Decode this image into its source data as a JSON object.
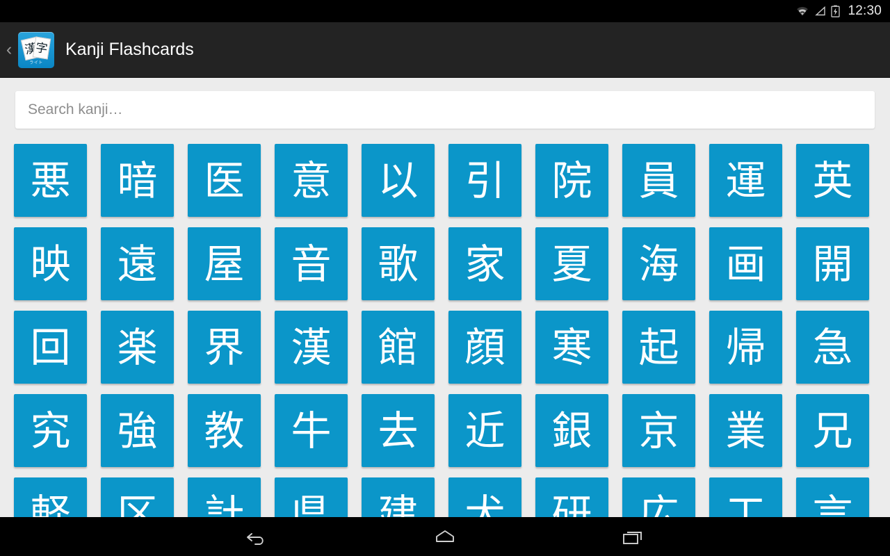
{
  "status_bar": {
    "clock": "12:30",
    "icons": [
      "wifi-icon",
      "signal-icon",
      "battery-charging-icon"
    ]
  },
  "action_bar": {
    "up_caret": "‹",
    "title": "Kanji Flashcards",
    "app_icon": {
      "name": "kanji-flashcards-app-icon",
      "card_back_char": "漢",
      "card_front_char": "字",
      "sub_label": "ライト"
    }
  },
  "search": {
    "placeholder": "Search kanji…",
    "value": ""
  },
  "grid": {
    "columns": 10,
    "rows": [
      [
        "悪",
        "暗",
        "医",
        "意",
        "以",
        "引",
        "院",
        "員",
        "運",
        "英"
      ],
      [
        "映",
        "遠",
        "屋",
        "音",
        "歌",
        "家",
        "夏",
        "海",
        "画",
        "開"
      ],
      [
        "回",
        "楽",
        "界",
        "漢",
        "館",
        "顔",
        "寒",
        "起",
        "帰",
        "急"
      ],
      [
        "究",
        "強",
        "教",
        "牛",
        "去",
        "近",
        "銀",
        "京",
        "業",
        "兄"
      ],
      [
        "軽",
        "区",
        "計",
        "県",
        "建",
        "犬",
        "研",
        "広",
        "工",
        "言"
      ]
    ]
  },
  "nav_bar": {
    "buttons": [
      "back-nav-button",
      "home-nav-button",
      "recents-nav-button"
    ]
  },
  "colors": {
    "tile_blue": "#0b96c9",
    "action_bar": "#232323",
    "page_background": "#ececec",
    "status_bar": "#000000"
  }
}
